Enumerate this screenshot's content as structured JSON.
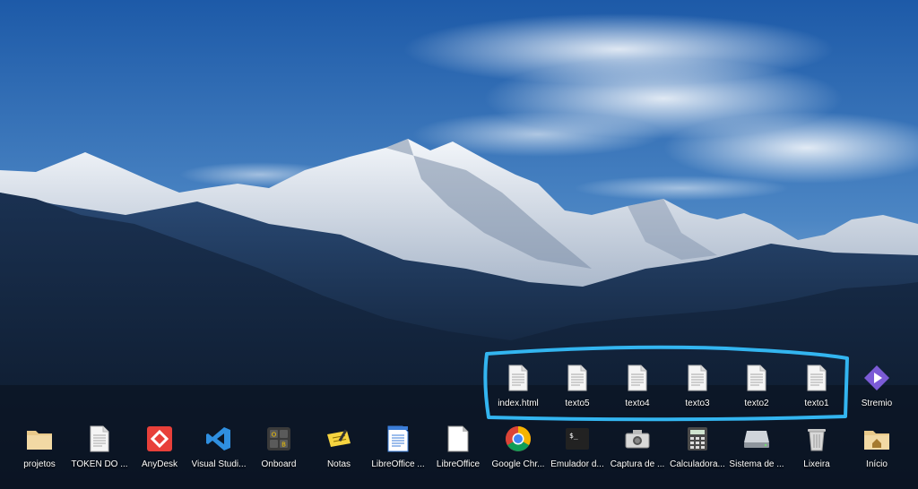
{
  "desktop": {
    "row_upper": [
      {
        "label": "index.html",
        "icon": "text-document-icon"
      },
      {
        "label": "texto5",
        "icon": "text-document-icon"
      },
      {
        "label": "texto4",
        "icon": "text-document-icon"
      },
      {
        "label": "texto3",
        "icon": "text-document-icon"
      },
      {
        "label": "texto2",
        "icon": "text-document-icon"
      },
      {
        "label": "texto1",
        "icon": "text-document-icon"
      },
      {
        "label": "Stremio",
        "icon": "stremio-icon"
      }
    ],
    "row_lower": [
      {
        "label": "projetos",
        "icon": "folder-icon"
      },
      {
        "label": "TOKEN DO ...",
        "icon": "text-document-icon"
      },
      {
        "label": "AnyDesk",
        "icon": "anydesk-icon"
      },
      {
        "label": "Visual Studi...",
        "icon": "vscode-icon"
      },
      {
        "label": "Onboard",
        "icon": "onboard-keyboard-icon"
      },
      {
        "label": "Notas",
        "icon": "notes-icon"
      },
      {
        "label": "LibreOffice ...",
        "icon": "libreoffice-writer-icon"
      },
      {
        "label": "LibreOffice",
        "icon": "libreoffice-icon"
      },
      {
        "label": "Google Chr...",
        "icon": "chrome-icon"
      },
      {
        "label": "Emulador d...",
        "icon": "terminal-icon"
      },
      {
        "label": "Captura de ...",
        "icon": "camera-icon"
      },
      {
        "label": "Calculadora...",
        "icon": "calculator-icon"
      },
      {
        "label": "Sistema de ...",
        "icon": "drive-icon"
      },
      {
        "label": "Lixeira",
        "icon": "trash-icon"
      },
      {
        "label": "Início",
        "icon": "home-folder-icon"
      }
    ]
  },
  "colors": {
    "selection_outline": "#33b5f0",
    "label_text": "#ffffff"
  }
}
